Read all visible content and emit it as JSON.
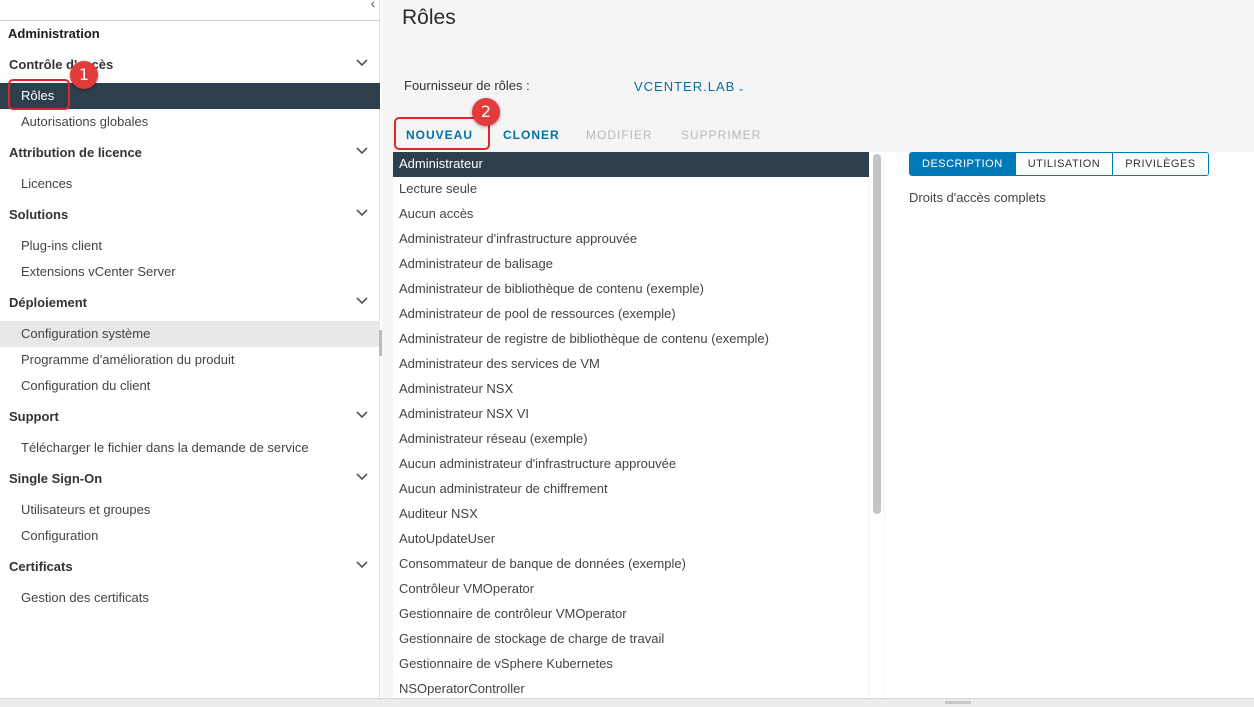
{
  "sidebar": {
    "collapse_icon": "chevron-left-icon",
    "title": "Administration",
    "sections": [
      {
        "label": "Contrôle d'accès",
        "items": [
          "Rôles",
          "Autorisations globales"
        ]
      },
      {
        "label": "Attribution de licence",
        "items": [
          "Licences"
        ]
      },
      {
        "label": "Solutions",
        "items": [
          "Plug-ins client",
          "Extensions vCenter Server"
        ]
      },
      {
        "label": "Déploiement",
        "items": [
          "Configuration système",
          "Programme d'amélioration du produit",
          "Configuration du client"
        ]
      },
      {
        "label": "Support",
        "items": [
          "Télécharger le fichier dans la demande de service"
        ]
      },
      {
        "label": "Single Sign-On",
        "items": [
          "Utilisateurs et groupes",
          "Configuration"
        ]
      },
      {
        "label": "Certificats",
        "items": [
          "Gestion des certificats"
        ]
      }
    ],
    "active_item": "Rôles",
    "hover_item": "Configuration système"
  },
  "callouts": [
    "1",
    "2"
  ],
  "main": {
    "title": "Rôles",
    "provider_label": "Fournisseur de rôles :",
    "provider_value": "VCENTER.LAB",
    "actions": [
      {
        "label": "NOUVEAU",
        "enabled": true
      },
      {
        "label": "CLONER",
        "enabled": true
      },
      {
        "label": "MODIFIER",
        "enabled": false
      },
      {
        "label": "SUPPRIMER",
        "enabled": false
      }
    ],
    "roles": [
      "Administrateur",
      "Lecture seule",
      "Aucun accès",
      "Administrateur d'infrastructure approuvée",
      "Administrateur de balisage",
      "Administrateur de bibliothèque de contenu (exemple)",
      "Administrateur de pool de ressources (exemple)",
      "Administrateur de registre de bibliothèque de contenu (exemple)",
      "Administrateur des services de VM",
      "Administrateur NSX",
      "Administrateur NSX VI",
      "Administrateur réseau (exemple)",
      "Aucun administrateur d'infrastructure approuvée",
      "Aucun administrateur de chiffrement",
      "Auditeur NSX",
      "AutoUpdateUser",
      "Consommateur de banque de données (exemple)",
      "Contrôleur VMOperator",
      "Gestionnaire de contrôleur VMOperator",
      "Gestionnaire de stockage de charge de travail",
      "Gestionnaire de vSphere Kubernetes",
      "NSOperatorController"
    ],
    "selected_role": "Administrateur",
    "tabs": [
      {
        "label": "DESCRIPTION",
        "active": true
      },
      {
        "label": "UTILISATION",
        "active": false
      },
      {
        "label": "PRIVILÈGES",
        "active": false
      }
    ],
    "description": "Droits d'accès complets"
  },
  "colors": {
    "accent": "#0072a3",
    "selected_bg": "#2d3e4c",
    "callout": "#e0262b"
  }
}
